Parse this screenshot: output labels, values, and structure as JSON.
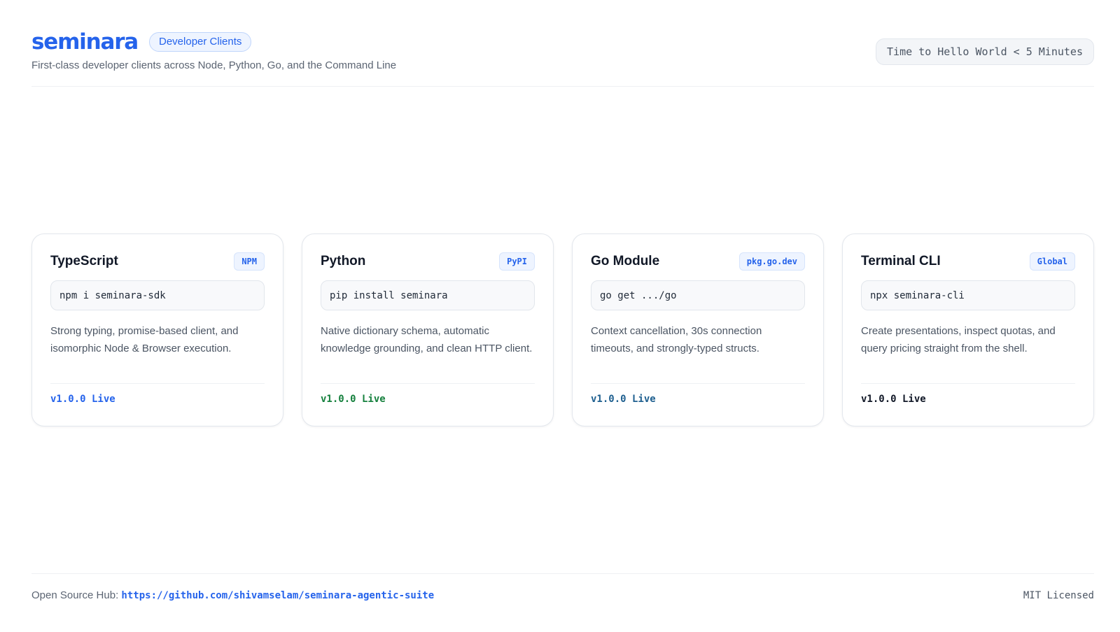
{
  "header": {
    "logo": "seminara",
    "pill": "Developer Clients",
    "subtitle": "First-class developer clients across Node, Python, Go, and the Command Line",
    "tagline": "Time to Hello World < 5 Minutes"
  },
  "cards": [
    {
      "title": "TypeScript",
      "badge": "NPM",
      "command": "npm i seminara-sdk",
      "description": "Strong typing, promise-based client, and isomorphic Node & Browser execution.",
      "status": "v1.0.0 Live",
      "status_color": "#2563eb"
    },
    {
      "title": "Python",
      "badge": "PyPI",
      "command": "pip install seminara",
      "description": "Native dictionary schema, automatic knowledge grounding, and clean HTTP client.",
      "status": "v1.0.0 Live",
      "status_color": "#15803d"
    },
    {
      "title": "Go Module",
      "badge": "pkg.go.dev",
      "command": "go get .../go",
      "description": "Context cancellation, 30s connection timeouts, and strongly-typed structs.",
      "status": "v1.0.0 Live",
      "status_color": "#1e5f8f"
    },
    {
      "title": "Terminal CLI",
      "badge": "Global",
      "command": "npx seminara-cli",
      "description": "Create presentations, inspect quotas, and query pricing straight from the shell.",
      "status": "v1.0.0 Live",
      "status_color": "#111827"
    }
  ],
  "footer": {
    "hub_label": "Open Source Hub:",
    "hub_url": "https://github.com/shivamselam/seminara-agentic-suite",
    "license": "MIT Licensed"
  },
  "colors": {
    "accent": "#2563eb"
  }
}
